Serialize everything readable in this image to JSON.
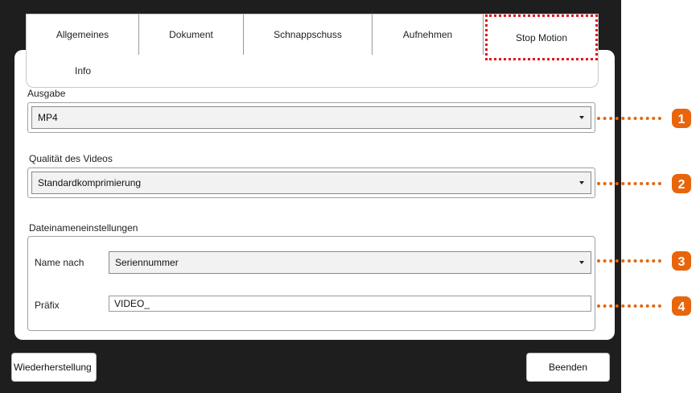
{
  "tabs": [
    {
      "label": "Allgemeines"
    },
    {
      "label": "Dokument"
    },
    {
      "label": "Schnappschuss"
    },
    {
      "label": "Aufnehmen"
    },
    {
      "label": "Stop Motion"
    }
  ],
  "tab_info": {
    "label": "Info"
  },
  "ausgabe": {
    "label": "Ausgabe",
    "value": "MP4"
  },
  "qualitaet": {
    "label": "Qualität des Videos",
    "value": "Standardkomprimierung"
  },
  "dateiname": {
    "label": "Dateinameneinstellungen",
    "name_label": "Name nach",
    "name_value": "Seriennummer",
    "prefix_label": "Präfix",
    "prefix_value": "VIDEO_"
  },
  "buttons": {
    "restore": "Wiederherstellung",
    "quit": "Beenden"
  },
  "callouts": [
    "1",
    "2",
    "3",
    "4"
  ],
  "colors": {
    "callout": "#e8650c",
    "active_tab_outline": "#e0161e"
  }
}
